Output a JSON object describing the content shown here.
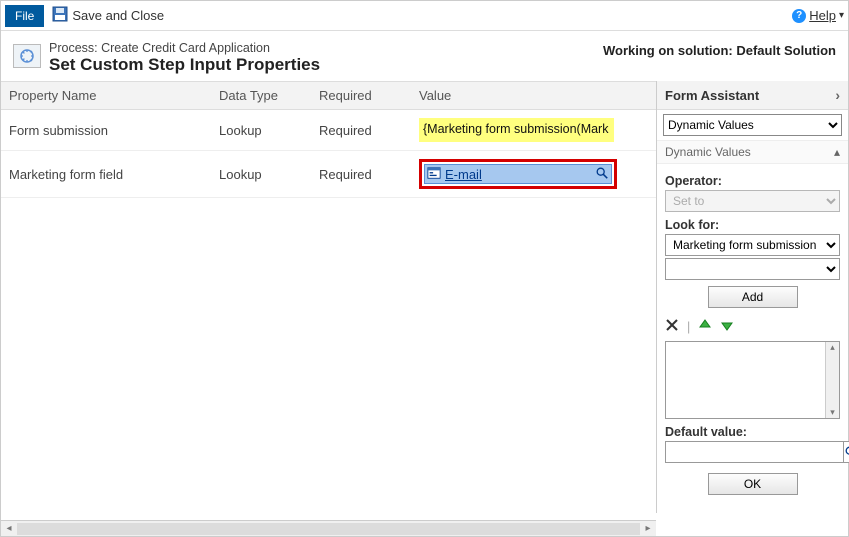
{
  "topbar": {
    "file": "File",
    "save_close": "Save and Close",
    "help": "Help"
  },
  "header": {
    "process_line": "Process: Create Credit Card Application",
    "title": "Set Custom Step Input Properties",
    "working_on": "Working on solution: Default Solution"
  },
  "columns": {
    "name": "Property Name",
    "datatype": "Data Type",
    "required": "Required",
    "value": "Value"
  },
  "rows": [
    {
      "name": "Form submission",
      "datatype": "Lookup",
      "required": "Required",
      "value": "{Marketing form submission(Mark"
    },
    {
      "name": "Marketing form field",
      "datatype": "Lookup",
      "required": "Required",
      "value": "E-mail"
    }
  ],
  "assistant": {
    "title": "Form Assistant",
    "section_select": "Dynamic Values",
    "section_label": "Dynamic Values",
    "operator_label": "Operator:",
    "operator_value": "Set to",
    "lookfor_label": "Look for:",
    "lookfor_value": "Marketing form submission",
    "lookfor_value2": "",
    "add": "Add",
    "default_label": "Default value:",
    "ok": "OK"
  }
}
